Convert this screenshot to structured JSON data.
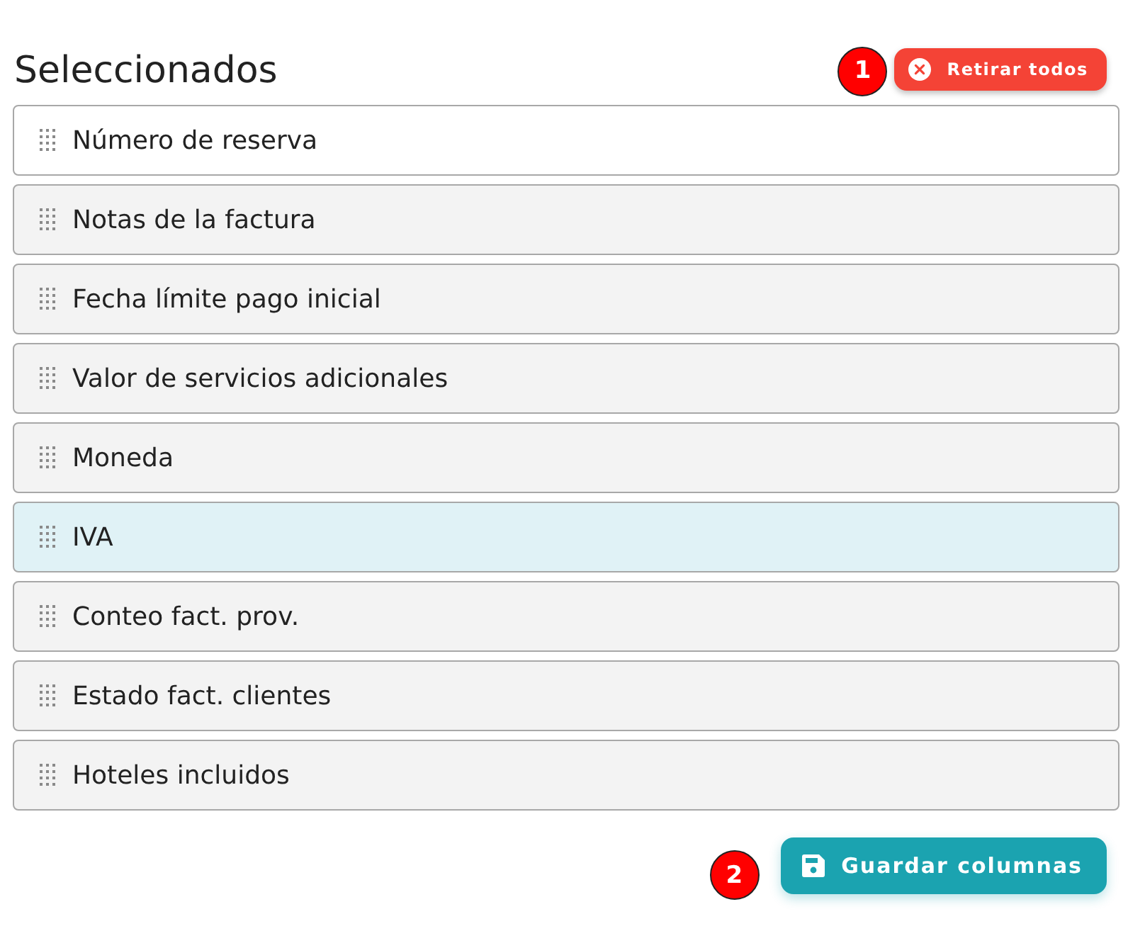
{
  "title": "Seleccionados",
  "remove_all_button": {
    "label": "Retirar todos",
    "marker": "1"
  },
  "columns": [
    {
      "label": "Número de reserva",
      "hovered": true,
      "selected": false
    },
    {
      "label": "Notas de la factura",
      "hovered": false,
      "selected": false
    },
    {
      "label": "Fecha límite pago inicial",
      "hovered": false,
      "selected": false
    },
    {
      "label": "Valor de servicios adicionales",
      "hovered": false,
      "selected": false
    },
    {
      "label": "Moneda",
      "hovered": false,
      "selected": false
    },
    {
      "label": "IVA",
      "hovered": false,
      "selected": true
    },
    {
      "label": "Conteo fact. prov.",
      "hovered": false,
      "selected": false
    },
    {
      "label": "Estado fact. clientes",
      "hovered": false,
      "selected": false
    },
    {
      "label": "Hoteles incluidos",
      "hovered": false,
      "selected": false
    }
  ],
  "save_button": {
    "label": "Guardar columnas",
    "marker": "2"
  }
}
